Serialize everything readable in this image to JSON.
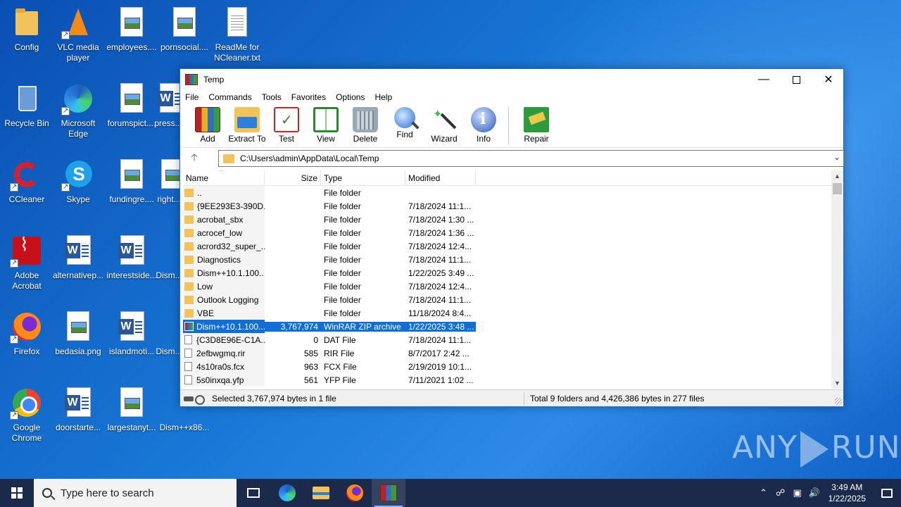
{
  "desktop": {
    "icons": [
      {
        "label": "Config",
        "icon": "folder-icon"
      },
      {
        "label": "VLC media player",
        "icon": "vlc-icon"
      },
      {
        "label": "employees....",
        "icon": "image-file-icon"
      },
      {
        "label": "pornsocial....",
        "icon": "image-file-icon"
      },
      {
        "label": "ReadMe for NCleaner.txt",
        "icon": "text-file-icon"
      },
      {
        "label": "Recycle Bin",
        "icon": "recycle-bin-icon"
      },
      {
        "label": "Microsoft Edge",
        "icon": "edge-icon"
      },
      {
        "label": "forumspict....",
        "icon": "image-file-icon"
      },
      {
        "label": "press...",
        "icon": "word-file-icon"
      },
      {
        "label": "CCleaner",
        "icon": "ccleaner-icon"
      },
      {
        "label": "Skype",
        "icon": "skype-icon"
      },
      {
        "label": "fundingre....",
        "icon": "image-file-icon"
      },
      {
        "label": "right...",
        "icon": "image-file-icon"
      },
      {
        "label": "Adobe Acrobat",
        "icon": "acrobat-icon"
      },
      {
        "label": "alternativep...",
        "icon": "word-file-icon"
      },
      {
        "label": "interestside...",
        "icon": "word-file-icon"
      },
      {
        "label": "Dism...",
        "icon": "image-file-icon"
      },
      {
        "label": "Firefox",
        "icon": "firefox-icon"
      },
      {
        "label": "bedasia.png",
        "icon": "image-file-icon"
      },
      {
        "label": "islandmoti...",
        "icon": "word-file-icon"
      },
      {
        "label": "Dism...",
        "icon": "image-file-icon"
      },
      {
        "label": "Google Chrome",
        "icon": "chrome-icon"
      },
      {
        "label": "doorstarte...",
        "icon": "word-file-icon"
      },
      {
        "label": "largestanyt...",
        "icon": "image-file-icon"
      },
      {
        "label": "Dism++x86...",
        "icon": "image-file-icon"
      }
    ]
  },
  "window": {
    "title": "Temp",
    "menu": [
      "File",
      "Commands",
      "Tools",
      "Favorites",
      "Options",
      "Help"
    ],
    "toolbar": [
      {
        "label": "Add",
        "icon": "add-icon"
      },
      {
        "label": "Extract To",
        "icon": "extract-icon"
      },
      {
        "label": "Test",
        "icon": "test-icon"
      },
      {
        "label": "View",
        "icon": "view-icon"
      },
      {
        "label": "Delete",
        "icon": "delete-icon"
      },
      {
        "label": "Find",
        "icon": "find-icon"
      },
      {
        "label": "Wizard",
        "icon": "wizard-icon"
      },
      {
        "label": "Info",
        "icon": "info-icon"
      },
      {
        "label": "Repair",
        "icon": "repair-icon"
      }
    ],
    "address": "C:\\Users\\admin\\AppData\\Local\\Temp",
    "columns": {
      "name": "Name",
      "size": "Size",
      "type": "Type",
      "modified": "Modified"
    },
    "rows": [
      {
        "name": "..",
        "size": "",
        "type": "File folder",
        "modified": "",
        "kind": "folder"
      },
      {
        "name": "{9EE293E3-390D...",
        "size": "",
        "type": "File folder",
        "modified": "7/18/2024 11:1...",
        "kind": "folder"
      },
      {
        "name": "acrobat_sbx",
        "size": "",
        "type": "File folder",
        "modified": "7/18/2024 1:30 ...",
        "kind": "folder"
      },
      {
        "name": "acrocef_low",
        "size": "",
        "type": "File folder",
        "modified": "7/18/2024 1:36 ...",
        "kind": "folder"
      },
      {
        "name": "acrord32_super_...",
        "size": "",
        "type": "File folder",
        "modified": "7/18/2024 12:4...",
        "kind": "folder"
      },
      {
        "name": "Diagnostics",
        "size": "",
        "type": "File folder",
        "modified": "7/18/2024 11:1...",
        "kind": "folder"
      },
      {
        "name": "Dism++10.1.100...",
        "size": "",
        "type": "File folder",
        "modified": "1/22/2025 3:49 ...",
        "kind": "folder"
      },
      {
        "name": "Low",
        "size": "",
        "type": "File folder",
        "modified": "7/18/2024 12:4...",
        "kind": "folder"
      },
      {
        "name": "Outlook Logging",
        "size": "",
        "type": "File folder",
        "modified": "7/18/2024 11:1...",
        "kind": "folder"
      },
      {
        "name": "VBE",
        "size": "",
        "type": "File folder",
        "modified": "11/18/2024 8:4...",
        "kind": "folder"
      },
      {
        "name": "Dism++10.1.100...",
        "size": "3,767,974",
        "type": "WinRAR ZIP archive",
        "modified": "1/22/2025 3:48 ...",
        "kind": "zip",
        "selected": true
      },
      {
        "name": "{C3D8E96E-C1A...",
        "size": "0",
        "type": "DAT File",
        "modified": "7/18/2024 11:1...",
        "kind": "file"
      },
      {
        "name": "2efbwgmq.rir",
        "size": "585",
        "type": "RIR File",
        "modified": "8/7/2017 2:42 ...",
        "kind": "file"
      },
      {
        "name": "4s10ra0s.fcx",
        "size": "963",
        "type": "FCX File",
        "modified": "2/19/2019 10:1...",
        "kind": "file"
      },
      {
        "name": "5s0inxqa.yfp",
        "size": "561",
        "type": "YFP File",
        "modified": "7/11/2021 1:02 ...",
        "kind": "file"
      }
    ],
    "status_left": "Selected 3,767,974 bytes in 1 file",
    "status_right": "Total 9 folders and 4,426,386 bytes in 277 files"
  },
  "watermark": {
    "left": "ANY",
    "right": "RUN"
  },
  "taskbar": {
    "search_placeholder": "Type here to search",
    "time": "3:49 AM",
    "date": "1/22/2025"
  },
  "colors": {
    "selection": "#0f6fd6",
    "taskbar": "#1b2a4a",
    "desktop": "#1877d6"
  }
}
